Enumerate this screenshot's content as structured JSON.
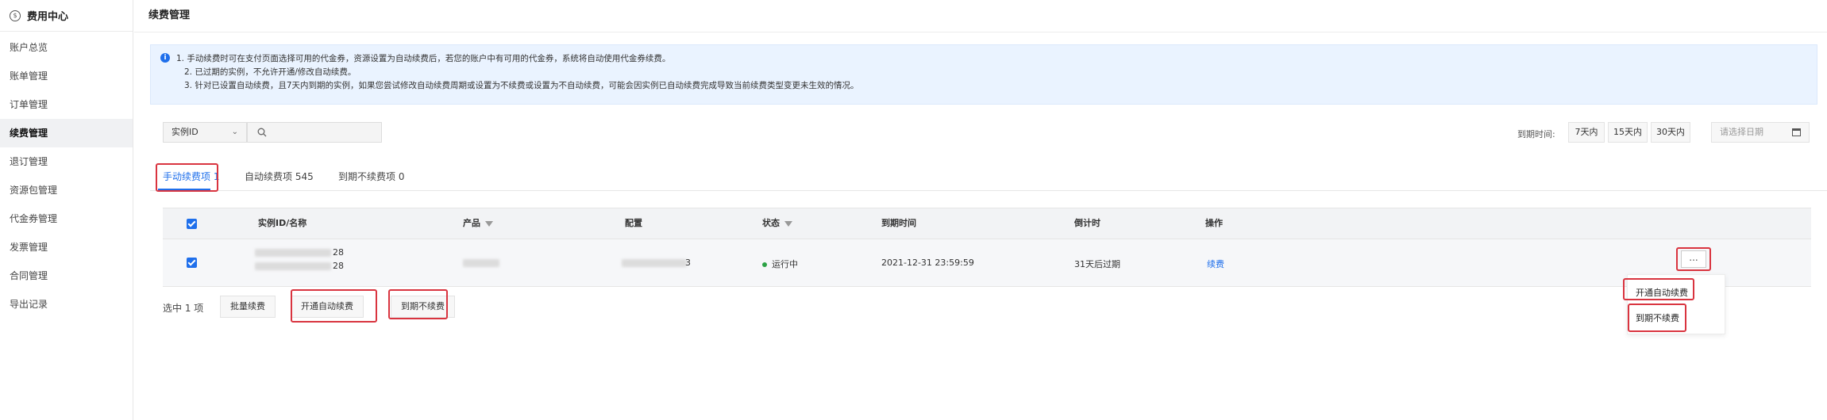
{
  "sidebar": {
    "title": "费用中心",
    "items": [
      {
        "label": "账户总览"
      },
      {
        "label": "账单管理"
      },
      {
        "label": "订单管理"
      },
      {
        "label": "续费管理"
      },
      {
        "label": "退订管理"
      },
      {
        "label": "资源包管理"
      },
      {
        "label": "代金券管理"
      },
      {
        "label": "发票管理"
      },
      {
        "label": "合同管理"
      },
      {
        "label": "导出记录"
      }
    ],
    "active_item": "续费管理"
  },
  "page": {
    "title": "续费管理"
  },
  "notice": {
    "lines": [
      "1. 手动续费时可在支付页面选择可用的代金券，资源设置为自动续费后，若您的账户中有可用的代金券，系统将自动使用代金券续费。",
      "2. 已过期的实例，不允许开通/修改自动续费。",
      "3. 针对已设置自动续费，且7天内到期的实例，如果您尝试修改自动续费周期或设置为不续费或设置为不自动续费，可能会因实例已自动续费完成导致当前续费类型变更未生效的情况。"
    ]
  },
  "filters": {
    "type_select": "实例ID",
    "search_value": "",
    "due_label": "到期时间:",
    "due_options": [
      "7天内",
      "15天内",
      "30天内"
    ],
    "date_placeholder": "请选择日期"
  },
  "tabs": [
    {
      "label": "手动续费项 1",
      "active": true
    },
    {
      "label": "自动续费项 545",
      "active": false
    },
    {
      "label": "到期不续费项 0",
      "active": false
    }
  ],
  "table": {
    "columns": [
      "实例ID/名称",
      "产品",
      "配置",
      "状态",
      "到期时间",
      "倒计时",
      "操作"
    ],
    "rows": [
      {
        "id_suffix": "28",
        "name_suffix": "28",
        "config_suffix": "3",
        "status": "运行中",
        "expire": "2021-12-31 23:59:59",
        "countdown": "31天后过期",
        "action": "续费",
        "more": "..."
      }
    ]
  },
  "row_menu": [
    "开通自动续费",
    "到期不续费"
  ],
  "bottom": {
    "selected_text": "选中 1 项",
    "buttons": [
      "批量续费",
      "开通自动续费",
      "到期不续费"
    ]
  },
  "colors": {
    "accent": "#1f6feb",
    "highlight": "#d9343f",
    "status_running": "#2ba245",
    "notice_bg": "#eaf3ff"
  }
}
